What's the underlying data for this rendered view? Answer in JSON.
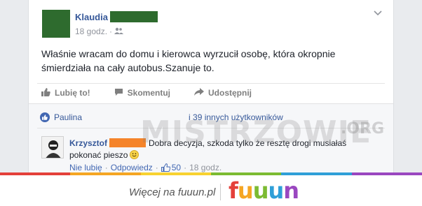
{
  "post": {
    "author_name": "Klaudia",
    "time": "18 godz.",
    "separator": "·",
    "text": "Właśnie wracam do domu i kierowca wyrzucił osobę, która okropnie śmierdziała na cały autobus.Szanuje to.",
    "actions": {
      "like": "Lubię to!",
      "comment": "Skomentuj",
      "share": "Udostępnij"
    }
  },
  "likes_summary": {
    "first_name": "Paulina",
    "others": "i 39 innych użytkowników"
  },
  "comment": {
    "author": "Krzysztof",
    "text": "Dobra decyzja, szkoda tylko że resztę drogi musiałaś pokonać pieszo",
    "unlike": "Nie lubię",
    "reply": "Odpowiedz",
    "like_count": "50",
    "time": "18 godz.",
    "dot": "·"
  },
  "watermark": {
    "main": "MISTRZOWIE",
    "org": ".ORG"
  },
  "footer": {
    "text": "Więcej na fuuun.pl",
    "logo_letters": [
      "f",
      "u",
      "u",
      "u",
      "n"
    ],
    "logo_colors": [
      "#e4403a",
      "#f5a623",
      "#7cbb32",
      "#2f9fd8",
      "#9a47c0"
    ]
  },
  "colors": {
    "link": "#365899",
    "accent": "#4267b2",
    "redact_green": "#2e6b2e",
    "redact_orange": "#f5842a",
    "rainbow": [
      "#e4403a",
      "#f5a623",
      "#f8d230",
      "#7cbb32",
      "#2f9fd8",
      "#9a47c0"
    ]
  }
}
